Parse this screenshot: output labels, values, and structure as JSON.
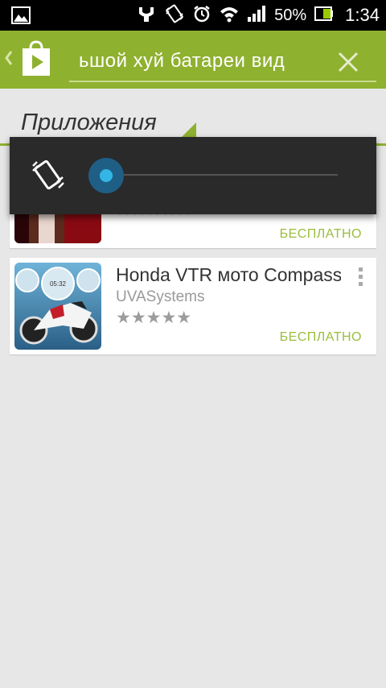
{
  "status_bar": {
    "battery_percent": "50%",
    "time": "1:34",
    "icons": [
      "gallery-icon",
      "usb-debug-icon",
      "vibrate-icon",
      "alarm-icon",
      "wifi-icon",
      "signal-icon",
      "battery-icon"
    ]
  },
  "search": {
    "query": "ьшой хуй батареи вид"
  },
  "section": {
    "title": "Приложения"
  },
  "apps": [
    {
      "title": "",
      "developer": "",
      "rating_stars": "★★★★★",
      "price": "БЕСПЛАТНО"
    },
    {
      "title": "Honda VTR мото Compass",
      "developer": "UVASystems",
      "rating_stars": "★★★★★",
      "price": "БЕСПЛАТНО",
      "thumb_clock": "05:32"
    }
  ],
  "volume_overlay": {
    "mode_icon": "vibrate-icon",
    "level": 0
  },
  "colors": {
    "action_bar": "#8fb130",
    "accent_green": "#9bbd3c",
    "slider_blue": "#33b5e5",
    "overlay_bg": "#2a2a2a"
  }
}
